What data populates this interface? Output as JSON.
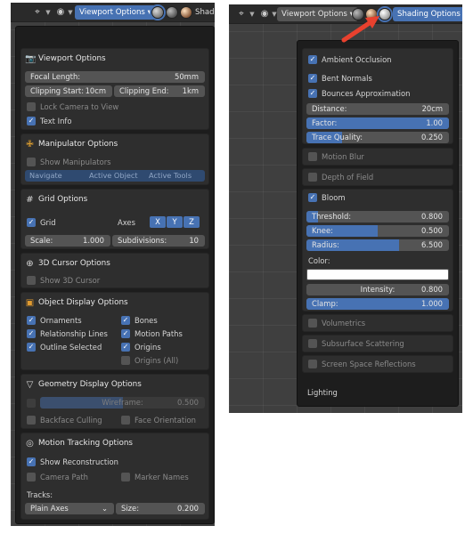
{
  "left": {
    "header": {
      "editor_type_icon": "3d-viewport-icon",
      "menu_label": "Viewport Options",
      "cut_label": "Shadi"
    },
    "viewport_options": {
      "title": "Viewport Options",
      "focal_length": {
        "label": "Focal Length:",
        "value": "50mm"
      },
      "clip_start": {
        "label": "Clipping Start:",
        "value": "10cm"
      },
      "clip_end": {
        "label": "Clipping End:",
        "value": "1km"
      },
      "lock_camera": {
        "label": "Lock Camera to View",
        "checked": false
      },
      "text_info": {
        "label": "Text Info",
        "checked": true
      }
    },
    "manipulator": {
      "title": "Manipulator Options",
      "show": {
        "label": "Show Manipulators",
        "checked": false
      },
      "modes": [
        "Navigate",
        "Active Object",
        "Active Tools"
      ]
    },
    "grid": {
      "title": "Grid Options",
      "grid_label": "Grid",
      "axes_label": "Axes",
      "axes": [
        "X",
        "Y",
        "Z"
      ],
      "scale": {
        "label": "Scale:",
        "value": "1.000"
      },
      "subdivisions": {
        "label": "Subdivisions:",
        "value": "10"
      }
    },
    "cursor": {
      "title": "3D Cursor Options",
      "show": {
        "label": "Show 3D Cursor",
        "checked": false
      }
    },
    "object_display": {
      "title": "Object Display Options",
      "left_items": [
        {
          "label": "Ornaments",
          "checked": true
        },
        {
          "label": "Relationship Lines",
          "checked": true
        },
        {
          "label": "Outline Selected",
          "checked": true
        }
      ],
      "right_items": [
        {
          "label": "Bones",
          "checked": true
        },
        {
          "label": "Motion Paths",
          "checked": true
        },
        {
          "label": "Origins",
          "checked": true
        },
        {
          "label": "Origins (All)",
          "checked": false
        }
      ]
    },
    "geometry": {
      "title": "Geometry Display Options",
      "wireframe": {
        "label": "Wireframe:",
        "value": "0.500",
        "fraction": 0.5
      },
      "backface": {
        "label": "Backface Culling",
        "checked": false
      },
      "face_orientation": {
        "label": "Face Orientation",
        "checked": false
      }
    },
    "motion_tracking": {
      "title": "Motion Tracking Options",
      "show_reconstruction": {
        "label": "Show Reconstruction",
        "checked": true
      },
      "camera_path": {
        "label": "Camera Path",
        "checked": false
      },
      "marker_names": {
        "label": "Marker Names",
        "checked": false
      },
      "tracks_label": "Tracks:",
      "tracks_value": "Plain Axes",
      "size": {
        "label": "Size:",
        "value": "0.200"
      }
    }
  },
  "right": {
    "header": {
      "editor_type_icon": "3d-viewport-icon",
      "menu_label": "Viewport Options",
      "shading_label": "Shading Options"
    },
    "ao": {
      "ambient_occlusion": {
        "label": "Ambient Occlusion",
        "checked": true
      },
      "bent_normals": {
        "label": "Bent Normals",
        "checked": true
      },
      "bounces": {
        "label": "Bounces Approximation",
        "checked": true
      },
      "distance": {
        "label": "Distance:",
        "value": "20cm"
      },
      "factor": {
        "label": "Factor:",
        "value": "1.00",
        "fraction": 1.0
      },
      "trace_quality": {
        "label": "Trace Quality:",
        "value": "0.250",
        "fraction": 0.25
      }
    },
    "motion_blur": {
      "label": "Motion Blur",
      "checked": false
    },
    "dof": {
      "label": "Depth of Field",
      "checked": false
    },
    "bloom": {
      "label": "Bloom",
      "checked": true,
      "threshold": {
        "label": "Threshold:",
        "value": "0.800",
        "fraction": 0.08
      },
      "knee": {
        "label": "Knee:",
        "value": "0.500",
        "fraction": 0.5
      },
      "radius": {
        "label": "Radius:",
        "value": "6.500",
        "fraction": 0.65
      },
      "color_label": "Color:",
      "color": "#ffffff",
      "intensity": {
        "label": "Intensity:",
        "value": "0.800"
      },
      "clamp": {
        "label": "Clamp:",
        "value": "1.000",
        "fraction": 1.0
      }
    },
    "volumetrics": {
      "label": "Volumetrics",
      "checked": false
    },
    "sss": {
      "label": "Subsurface Scattering",
      "checked": false
    },
    "ssr": {
      "label": "Screen Space Reflections",
      "checked": false
    },
    "lighting_label": "Lighting"
  },
  "colors": {
    "accent": "#4772b3",
    "arrow": "#e8412e"
  }
}
